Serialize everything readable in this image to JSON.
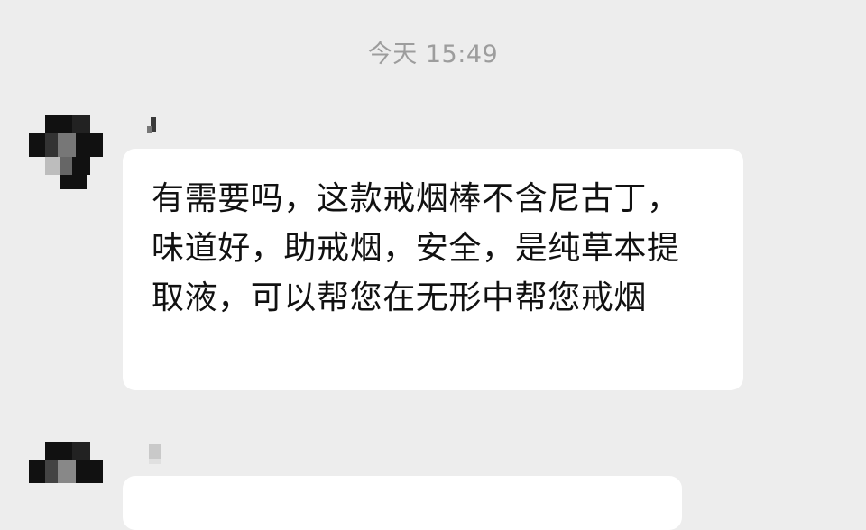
{
  "chat": {
    "timestamp": "今天 15:49",
    "messages": [
      {
        "text": "有需要吗，这款戒烟棒不含尼古丁，味道好，助戒烟，安全，是纯草本提取液，可以帮您在无形中帮您戒烟"
      },
      {
        "text": ""
      }
    ]
  }
}
